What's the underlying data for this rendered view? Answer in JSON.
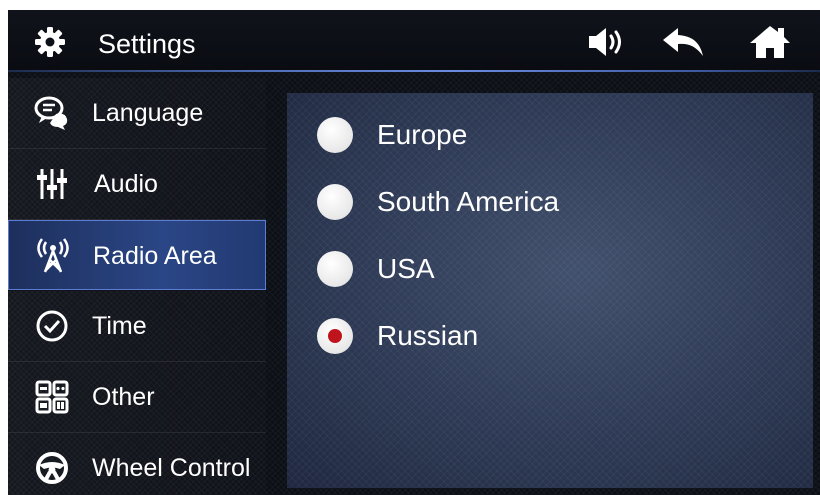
{
  "header": {
    "title": "Settings",
    "icons": [
      "gear-icon",
      "volume-icon",
      "back-icon",
      "home-icon"
    ]
  },
  "sidebar": {
    "items": [
      {
        "label": "Language",
        "icon": "chat-bubbles-icon",
        "active": false
      },
      {
        "label": "Audio",
        "icon": "equalizer-icon",
        "active": false
      },
      {
        "label": "Radio Area",
        "icon": "antenna-icon",
        "active": true
      },
      {
        "label": "Time",
        "icon": "clock-check-icon",
        "active": false
      },
      {
        "label": "Other",
        "icon": "grid-apps-icon",
        "active": false
      },
      {
        "label": "Wheel Control",
        "icon": "steering-wheel-icon",
        "active": false
      }
    ]
  },
  "radio_area": {
    "options": [
      {
        "label": "Europe",
        "selected": false
      },
      {
        "label": "South America",
        "selected": false
      },
      {
        "label": "USA",
        "selected": false
      },
      {
        "label": "Russian",
        "selected": true
      }
    ]
  },
  "colors": {
    "active_item": "#2b4686",
    "selected_dot": "#c0141c",
    "header_line": "#6b8be0"
  }
}
